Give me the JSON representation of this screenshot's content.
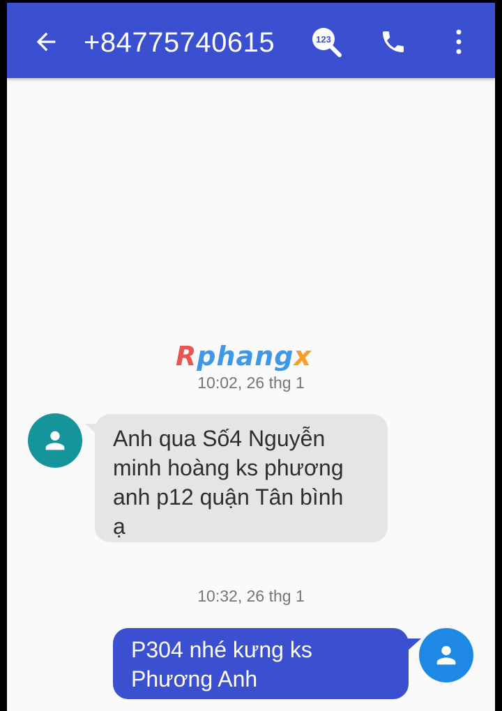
{
  "header": {
    "back_icon": "arrow-left-icon",
    "title": "+84775740615",
    "search_badge": "123",
    "search_icon": "search-numbers-icon",
    "call_icon": "phone-icon",
    "menu_icon": "more-vertical-icon"
  },
  "watermark": {
    "text": "Rphangx",
    "colors": [
      "#e53935",
      "#1e88e5",
      "#1e88e5",
      "#1e88e5",
      "#1e88e5",
      "#1e88e5",
      "#fb8c00"
    ]
  },
  "conversation": {
    "messages": [
      {
        "timestamp": "10:02, 26 thg 1",
        "direction": "incoming",
        "avatar_icon": "person-icon",
        "avatar_color": "#16949c",
        "text": "Anh qua Số4 Nguyễn\nminh hoàng ks phương\nanh p12 quận Tân bình\nạ"
      },
      {
        "timestamp": "10:32, 26 thg 1",
        "direction": "outgoing",
        "avatar_icon": "person-icon",
        "avatar_color": "#1e88e5",
        "text": "P304 nhé kưng ks\nPhương Anh"
      }
    ]
  },
  "colors": {
    "appbar": "#3b4fd1",
    "incoming_bubble": "#e5e5e8",
    "outgoing_bubble": "#3b4fd1"
  }
}
